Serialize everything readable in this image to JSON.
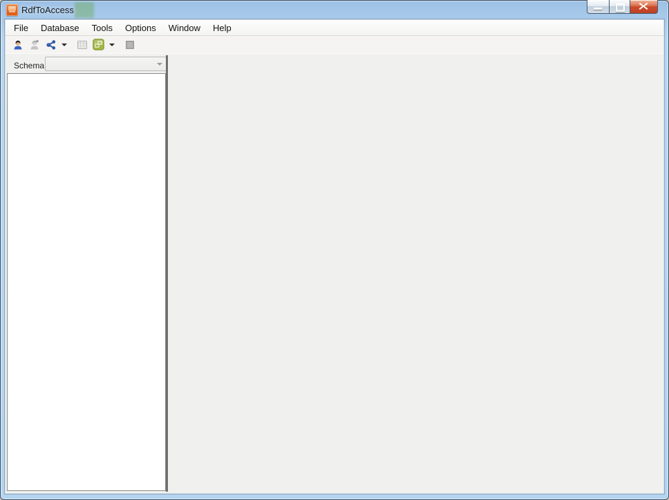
{
  "window": {
    "title": "RdfToAccess",
    "controls": {
      "minimize_icon": "minimize-icon",
      "maximize_icon": "maximize-icon",
      "close_icon": "close-icon"
    }
  },
  "menu": {
    "items": [
      {
        "label": "File"
      },
      {
        "label": "Database"
      },
      {
        "label": "Tools"
      },
      {
        "label": "Options"
      },
      {
        "label": "Window"
      },
      {
        "label": "Help"
      }
    ]
  },
  "toolbar": {
    "buttons": [
      {
        "name": "connect-user",
        "icon": "user-icon",
        "enabled": true
      },
      {
        "name": "disconnect-user",
        "icon": "user-x-icon",
        "enabled": false
      },
      {
        "name": "share-graph",
        "icon": "share-nodes-icon",
        "enabled": true,
        "has_dropdown": true
      },
      {
        "name": "table-view",
        "icon": "table-icon",
        "enabled": false
      },
      {
        "name": "export-access",
        "icon": "overlapping-windows-icon",
        "enabled": true,
        "has_dropdown": true
      },
      {
        "name": "stop",
        "icon": "stop-square-icon",
        "enabled": false
      }
    ]
  },
  "sidebar": {
    "schema_label": "Schema",
    "schema_value": ""
  },
  "colors": {
    "titlebar_glass": "#b4d4f0",
    "close_button_red": "#cb4c2c",
    "toolbar_blue_icon": "#2b55a4",
    "toolbar_green_icon": "#97ac36",
    "client_background": "#f0f0ee",
    "splitter_gray": "#6f6f6f"
  }
}
